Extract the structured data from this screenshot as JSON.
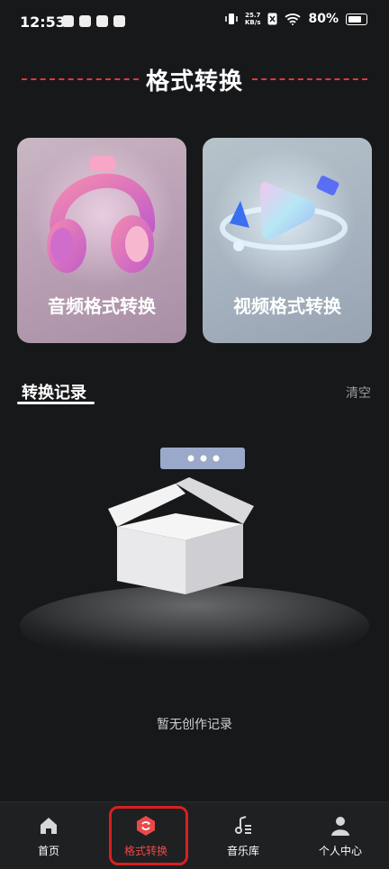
{
  "status_bar": {
    "time": "12:53",
    "net_speed_value": "25.7",
    "net_speed_unit": "KB/s",
    "battery": "80%"
  },
  "header": {
    "title": "格式转换"
  },
  "cards": {
    "audio_label": "音频格式转换",
    "video_label": "视频格式转换"
  },
  "records": {
    "tab_label": "转换记录",
    "clear_label": "清空",
    "empty_text": "暂无创作记录"
  },
  "bottom_nav": {
    "items": [
      {
        "label": "首页",
        "icon": "home-icon"
      },
      {
        "label": "格式转换",
        "icon": "convert-icon",
        "active": true
      },
      {
        "label": "音乐库",
        "icon": "music-note-icon"
      },
      {
        "label": "个人中心",
        "icon": "person-icon"
      }
    ],
    "active_color": "#e84a4a"
  },
  "colors": {
    "background": "#17181a",
    "accent": "#d93a3a"
  }
}
